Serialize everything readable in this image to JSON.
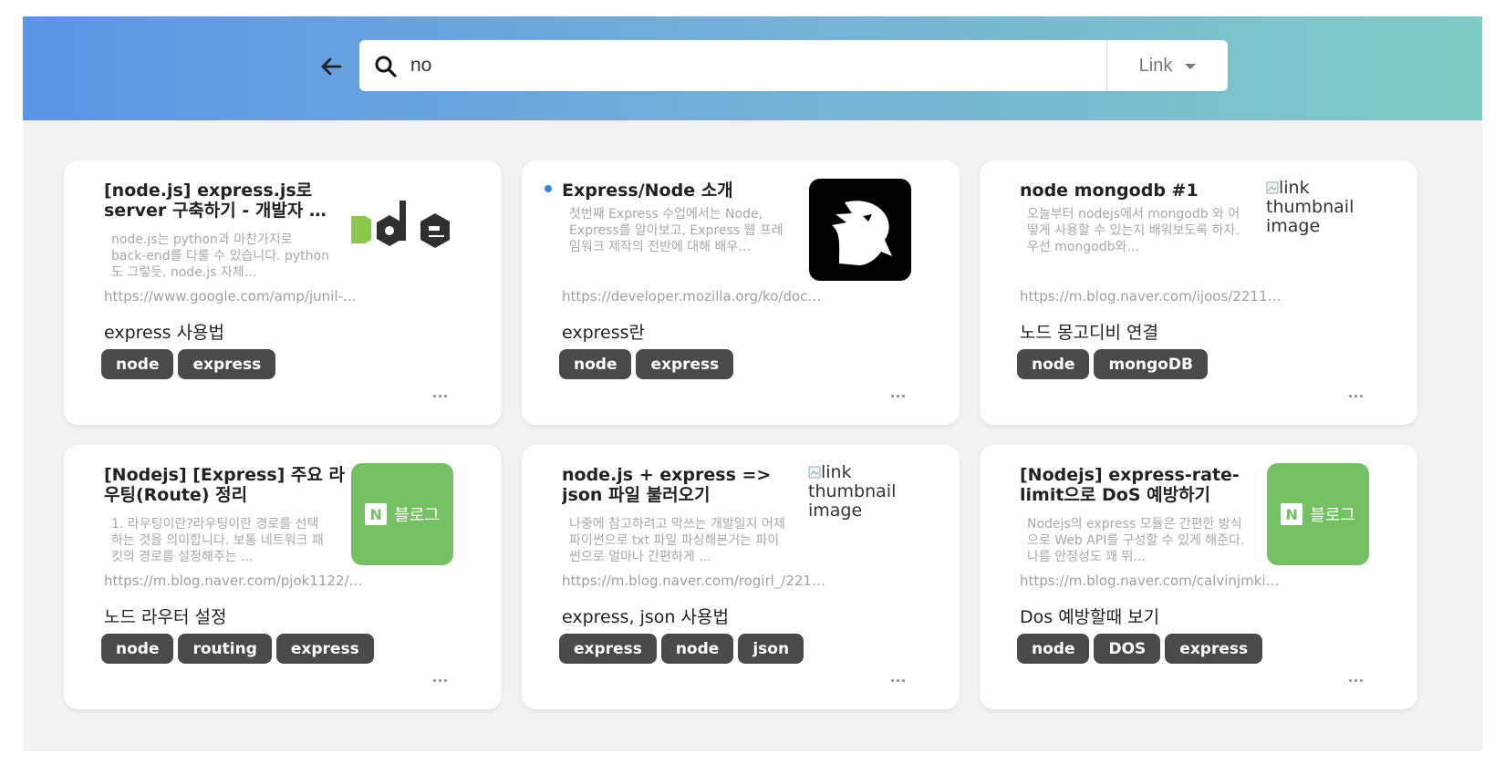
{
  "search": {
    "value": "no",
    "type_label": "Link"
  },
  "thumbnail_alt": "link thumbnail image",
  "blog_label": "블로그",
  "blog_letter": "N",
  "cards": [
    {
      "title": "[node.js] express.js로 server 구축하기 - 개발자 …",
      "description": "node.js는 python과 마찬가지로 back-end를 다룰 수 있습니다. python도 그렇듯, node.js 자체…",
      "url": "https://www.google.com/amp/junil-…",
      "memo": "express 사용법",
      "tags": [
        "node",
        "express"
      ],
      "thumbnail": "node-logo"
    },
    {
      "title": "Express/Node 소개",
      "description": "첫번째 Express 수업에서는 Node, Express를 알아보고, Express 웹 프레임워크 제작의 전반에 대해 배우…",
      "url": "https://developer.mozilla.org/ko/doc…",
      "memo": "express란",
      "tags": [
        "node",
        "express"
      ],
      "thumbnail": "mdn-dino-logo",
      "new": true
    },
    {
      "title": "node mongodb #1",
      "description": "오늘부터 nodejs에서 mongodb 와 어떻게 사용할 수 있는지 배워보도록 하자. 우선 mongodb와…",
      "url": "https://m.blog.naver.com/ijoos/2211…",
      "memo": "노드 몽고디비 연결",
      "tags": [
        "node",
        "mongoDB"
      ],
      "thumbnail": "broken"
    },
    {
      "title": "[Nodejs] [Express] 주요 라우팅(Route) 정리",
      "description": "1. 라우팅이란?라우팅이란 경로를 선택하는 것을 의미합니다. 보통 네트워크 패킷의 경로를 설정해주는 ...",
      "url": "https://m.blog.naver.com/pjok1122/…",
      "memo": "노드 라우터 설정",
      "tags": [
        "node",
        "routing",
        "express"
      ],
      "thumbnail": "naver-blog"
    },
    {
      "title": "node.js + express => json 파일 불러오기",
      "description": "나중에 참고하려고 막쓰는 개발일지 어제 파이썬으로 txt 파일 파싱해본거는 파이썬으로 얼마나 간편하게 ...",
      "url": "https://m.blog.naver.com/rogirl_/221…",
      "memo": "express, json 사용법",
      "tags": [
        "express",
        "node",
        "json"
      ],
      "thumbnail": "broken"
    },
    {
      "title": "[Nodejs] express-rate-limit으로 DoS 예방하기",
      "description": "Nodejs의 express 모듈은 간편한 방식으로 Web API를 구성할 수 있게 해준다. 나름 안정성도 꽤 뛰...",
      "url": "https://m.blog.naver.com/calvinjmki…",
      "memo": "Dos 예방할때 보기",
      "tags": [
        "node",
        "DOS",
        "express"
      ],
      "thumbnail": "naver-blog"
    }
  ]
}
